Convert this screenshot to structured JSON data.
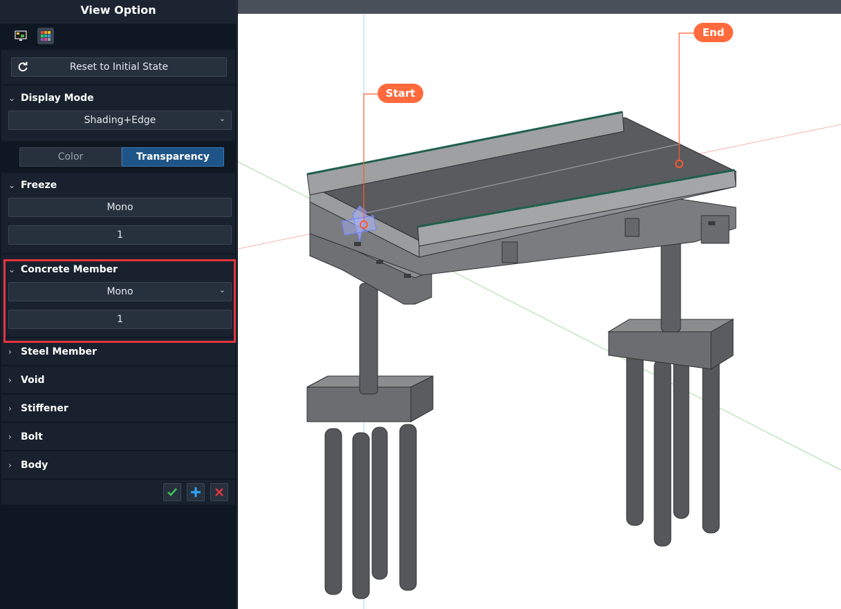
{
  "panel": {
    "title": "View Option",
    "icons": [
      "monitor-icon",
      "palette-grid-icon"
    ],
    "reset_label": "Reset to Initial State",
    "display_mode": {
      "header": "Display Mode",
      "value": "Shading+Edge"
    },
    "tabs": {
      "color": "Color",
      "transparency": "Transparency",
      "active": "Transparency"
    },
    "freeze": {
      "header": "Freeze",
      "mode": "Mono",
      "value": "1"
    },
    "concrete_member": {
      "header": "Concrete Member",
      "mode": "Mono",
      "value": "1"
    },
    "collapsed_sections": [
      "Steel Member",
      "Void",
      "Stiffener",
      "Bolt",
      "Body"
    ],
    "footer_buttons": [
      "check-icon",
      "plus-icon",
      "close-icon"
    ]
  },
  "viewport": {
    "callouts": {
      "start": "Start",
      "end": "End"
    },
    "colors": {
      "callout": "#ff6a3d",
      "highlight": "#e5353d",
      "active_tab": "#1e5586"
    }
  }
}
